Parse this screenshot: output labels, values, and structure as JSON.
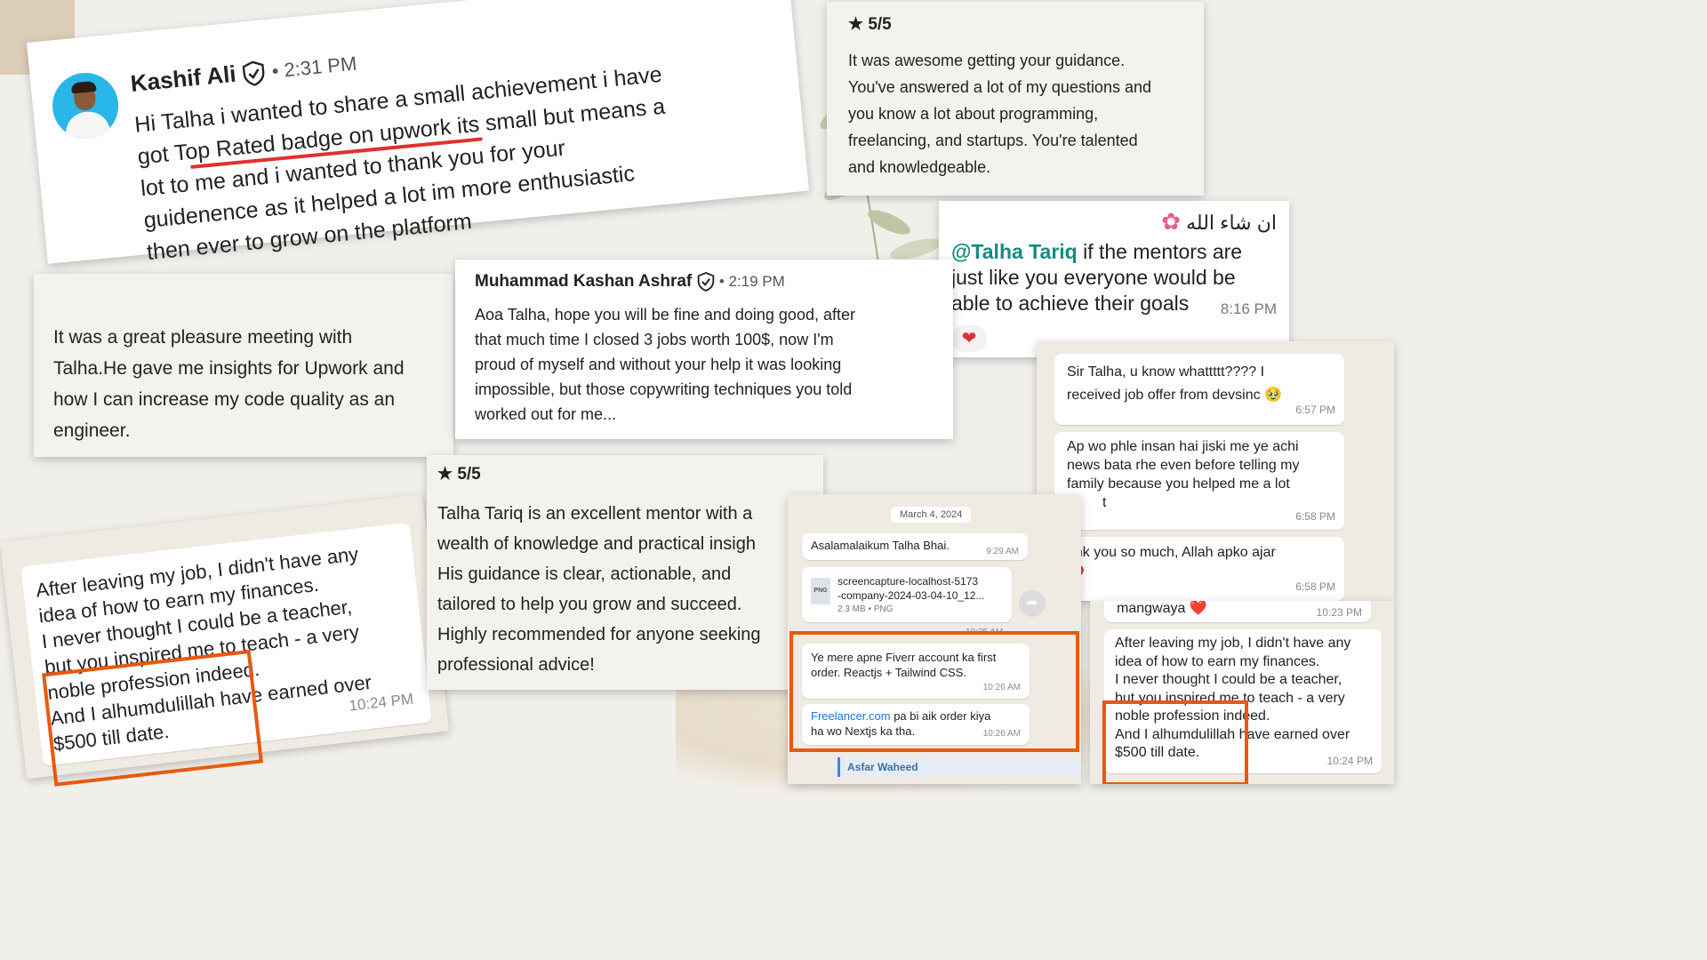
{
  "card_kashif": {
    "author": "Kashif Ali",
    "time": "2:31 PM",
    "message_lines": [
      "Hi Talha i wanted to share a small achievement i have",
      "got  Top Rated badge on upwork its small but means a",
      "lot to me and i wanted to thank you for your",
      "guidenence as it helped a lot im more enthusiastic",
      "then ever to grow on the platform"
    ]
  },
  "card_review_1": {
    "rating": "5/5",
    "message_lines": [
      "It was awesome getting your guidance.",
      "You've answered a lot of my questions and",
      "you know a lot about programming,",
      "freelancing, and startups. You're talented",
      "and knowledgeable."
    ]
  },
  "card_mentor_wa": {
    "urdu": "ان شاء الله",
    "mention": "@Talha Tariq",
    "message_lines": [
      " if the mentors are",
      "just like you everyone would be",
      "able to achieve their goals"
    ],
    "time": "8:16 PM",
    "reaction": "❤️"
  },
  "card_pleasure": {
    "message_lines": [
      "It was a great pleasure meeting with",
      "Talha.He gave me insights for Upwork and",
      "how I can increase my code quality as an",
      "engineer."
    ]
  },
  "card_kashan": {
    "author": "Muhammad Kashan Ashraf",
    "time": "2:19 PM",
    "message_lines": [
      "Aoa Talha, hope you will be fine and doing good, after",
      "that much time I closed 3 jobs worth 100$, now I'm",
      "proud of myself and without your help it was looking",
      "impossible, but those copywriting techniques you told",
      "worked out for me..."
    ]
  },
  "card_devsinc": {
    "messages": [
      {
        "lines": [
          "Sir Talha, u know whattttt???? I",
          "received job offer from devsinc 🥹"
        ],
        "time": "6:57 PM"
      },
      {
        "lines": [
          "Ap wo phle insan hai jiski me ye achi",
          "news bata rhe even before telling my",
          "family because you helped me a lot",
          "t"
        ],
        "time": "6:58 PM"
      },
      {
        "lines": [
          "ank you so much, Allah apko ajar",
          "❤️"
        ],
        "time": "6:58 PM"
      }
    ]
  },
  "card_left_job": {
    "message_lines": [
      "After leaving my job, I didn't have any",
      "idea of how to earn my finances.",
      "I never thought I could be a teacher,",
      "but you inspired me to teach - a very",
      "noble profession indeed.",
      "And I alhumdulillah have earned over",
      "$500 till date."
    ],
    "time": "10:24 PM"
  },
  "card_review_2": {
    "rating": "5/5",
    "message_lines": [
      "Talha Tariq is an excellent mentor with a",
      "wealth of knowledge and practical insigh",
      "His guidance is clear, actionable, and",
      "tailored to help you grow and succeed.",
      "Highly recommended for anyone seeking",
      "professional advice!"
    ]
  },
  "card_fiverr": {
    "date": "March 4, 2024",
    "greeting": "Asalamalaikum Talha Bhai.",
    "greeting_time": "9:29 AM",
    "file_name_lines": [
      "screencapture-localhost-5173",
      "-company-2024-03-04-10_12..."
    ],
    "file_meta": "2.3 MB • PNG",
    "file_type": "PNG",
    "file_time": "10:25 AM",
    "msg1_lines": [
      "Ye mere apne Fiverr account ka first",
      "order. Reactjs + Tailwind CSS."
    ],
    "msg1_time": "10:26 AM",
    "msg2_link": "Freelancer.com",
    "msg2_lines": [
      " pa bi aik order kiya",
      "ha wo Nextjs ka tha."
    ],
    "msg2_time": "10:26 AM",
    "reply_author": "Asfar Waheed"
  },
  "card_left_job_2": {
    "top_text": "mangwaya ❤️",
    "top_time": "10:23 PM",
    "message_lines": [
      "After leaving my job, I didn't have any",
      "idea of how to earn my finances.",
      "I never thought I could be a teacher,",
      "but you inspired me to teach - a very",
      "noble profession indeed.",
      "And I alhumdulillah have earned over",
      "$500 till date."
    ],
    "time": "10:24 PM"
  },
  "colors": {
    "orange_highlight": "#e8590c",
    "red_underline": "#e03131",
    "mention_green": "#128c7e",
    "link_blue": "#1a73e8",
    "review_bg": "#f4f2ee"
  }
}
